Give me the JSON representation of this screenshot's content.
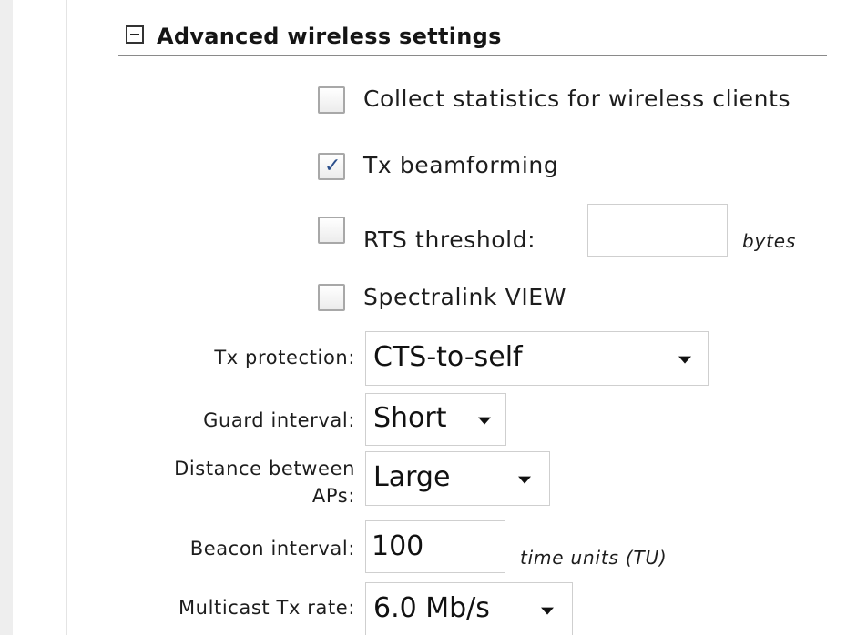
{
  "section": {
    "title": "Advanced wireless settings",
    "toggle_icon": "minus-box-icon"
  },
  "options": {
    "collect_stats": {
      "label": "Collect statistics for wireless clients",
      "checked": false
    },
    "tx_beamforming": {
      "label": "Tx beamforming",
      "checked": true
    },
    "rts_threshold": {
      "label": "RTS threshold:",
      "checked": false,
      "value": "",
      "unit": "bytes"
    },
    "spectralink": {
      "label": "Spectralink VIEW",
      "checked": false
    }
  },
  "fields": {
    "tx_protection": {
      "label": "Tx protection:",
      "value": "CTS-to-self"
    },
    "guard_interval": {
      "label": "Guard interval:",
      "value": "Short"
    },
    "distance_aps": {
      "label_line1": "Distance between",
      "label_line2": "APs:",
      "value": "Large"
    },
    "beacon_interval": {
      "label": "Beacon interval:",
      "value": "100",
      "unit": "time units (TU)"
    },
    "multicast_rate": {
      "label": "Multicast Tx rate:",
      "value": "6.0 Mb/s"
    }
  },
  "colors": {
    "check": "#2b4f8c",
    "border": "#a8a8a8",
    "rule": "#8a8a8a"
  }
}
